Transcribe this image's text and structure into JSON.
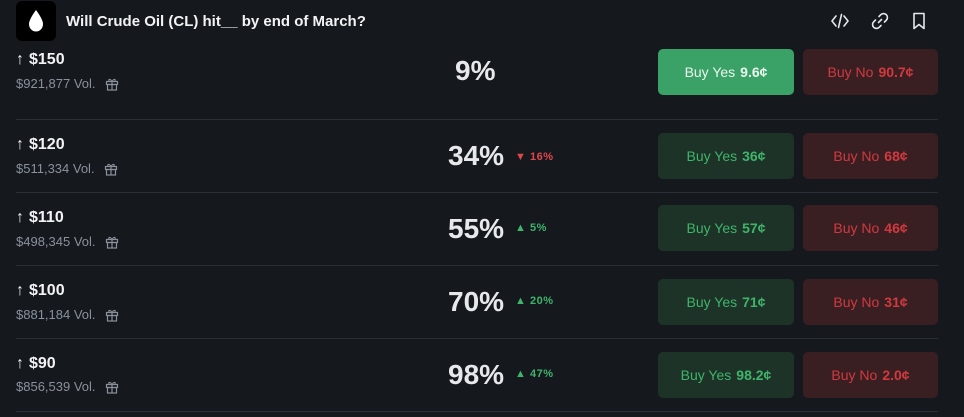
{
  "header": {
    "title": "Will Crude Oil (CL) hit__ by end of March?",
    "icons": [
      "oil-drop-icon",
      "embed-code-icon",
      "link-icon",
      "bookmark-icon"
    ]
  },
  "colors": {
    "background": "#15181d",
    "yes": "#3fb46b",
    "yes_active_bg": "#3aa266",
    "no": "#d2393f"
  },
  "rows": [
    {
      "arrow": "↑",
      "strike": "$150",
      "volume": "$921,877 Vol.",
      "chance": "9%",
      "change_arrow": "",
      "change": "",
      "yes_label": "Buy Yes",
      "yes_price": "9.6¢",
      "no_label": "Buy No",
      "no_price": "90.7¢"
    },
    {
      "arrow": "↑",
      "strike": "$120",
      "volume": "$511,334 Vol.",
      "chance": "34%",
      "change_arrow": "▼",
      "change": "16%",
      "yes_label": "Buy Yes",
      "yes_price": "36¢",
      "no_label": "Buy No",
      "no_price": "68¢"
    },
    {
      "arrow": "↑",
      "strike": "$110",
      "volume": "$498,345 Vol.",
      "chance": "55%",
      "change_arrow": "▲",
      "change": "5%",
      "yes_label": "Buy Yes",
      "yes_price": "57¢",
      "no_label": "Buy No",
      "no_price": "46¢"
    },
    {
      "arrow": "↑",
      "strike": "$100",
      "volume": "$881,184 Vol.",
      "chance": "70%",
      "change_arrow": "▲",
      "change": "20%",
      "yes_label": "Buy Yes",
      "yes_price": "71¢",
      "no_label": "Buy No",
      "no_price": "31¢"
    },
    {
      "arrow": "↑",
      "strike": "$90",
      "volume": "$856,539 Vol.",
      "chance": "98%",
      "change_arrow": "▲",
      "change": "47%",
      "yes_label": "Buy Yes",
      "yes_price": "98.2¢",
      "no_label": "Buy No",
      "no_price": "2.0¢"
    }
  ]
}
